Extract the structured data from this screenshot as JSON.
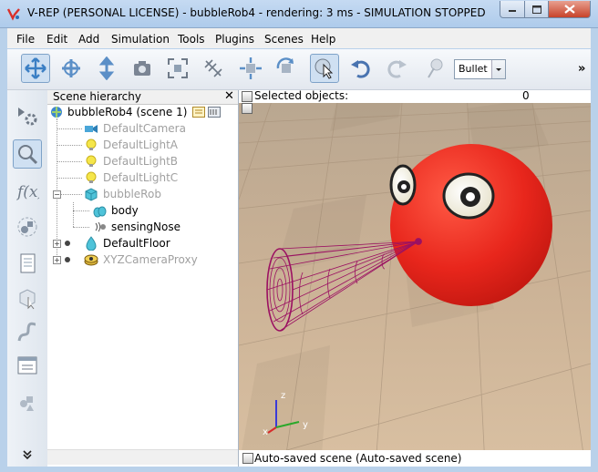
{
  "window": {
    "title": "V-REP (PERSONAL LICENSE) - bubbleRob4 - rendering: 3 ms - SIMULATION STOPPED",
    "app_icon": "vrep-logo-icon",
    "controls": [
      "minimize-icon",
      "maximize-icon",
      "close-icon"
    ]
  },
  "menu": [
    "File",
    "Edit",
    "Add",
    "Simulation",
    "Tools",
    "Plugins",
    "Scenes",
    "Help"
  ],
  "toolbar": {
    "physics_engine": "Bullet",
    "overflow": "»",
    "buttons": [
      "camera-pan-icon",
      "camera-rotate-icon",
      "camera-shift-icon",
      "camera-angle-icon",
      "fit-to-view-icon",
      "fly-icon",
      "object-shift-icon",
      "object-rotate-icon",
      "click-select-icon",
      "undo-icon",
      "redo-icon",
      "dynamics-settings-icon"
    ]
  },
  "left_toolbar": [
    "simulation-settings-icon",
    "scene-hierarchy-icon",
    "calculation-modules-icon",
    "model-browser-icon",
    "scene-selector-icon",
    "selection-icon",
    "path-icon",
    "user-settings-icon",
    "collections-icon",
    "more-icon"
  ],
  "hierarchy": {
    "title": "Scene hierarchy",
    "close": "✕",
    "scene_label": "bubbleRob4 (scene 1)",
    "items": [
      {
        "label": "DefaultCamera",
        "icon": "camera-icon",
        "dim": true
      },
      {
        "label": "DefaultLightA",
        "icon": "light-icon",
        "dim": true
      },
      {
        "label": "DefaultLightB",
        "icon": "light-icon",
        "dim": true
      },
      {
        "label": "DefaultLightC",
        "icon": "light-icon",
        "dim": true
      },
      {
        "label": "bubbleRob",
        "icon": "shape-icon",
        "dim": true
      },
      {
        "label": "body",
        "icon": "shape-icon",
        "dim": false
      },
      {
        "label": "sensingNose",
        "icon": "proximity-sensor-icon",
        "dim": false
      },
      {
        "label": "DefaultFloor",
        "icon": "shape-icon",
        "dim": false
      },
      {
        "label": "XYZCameraProxy",
        "icon": "dummy-icon",
        "dim": true
      }
    ]
  },
  "viewport": {
    "selected_label": "Selected objects:",
    "selected_count": "0",
    "status": "Auto-saved scene (Auto-saved scene)",
    "axes": [
      "x",
      "y",
      "z"
    ]
  },
  "colors": {
    "robot": "#e8261c",
    "sensor": "#9b1062",
    "floor": "#c9ab8b"
  }
}
